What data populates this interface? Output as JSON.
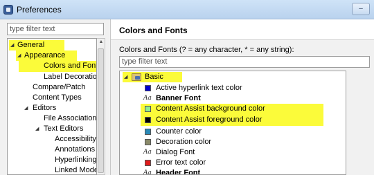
{
  "window": {
    "title": "Preferences"
  },
  "left_panel": {
    "filter_placeholder": "type filter text",
    "tree": [
      {
        "label": "General",
        "expanded": true
      },
      {
        "label": "Appearance",
        "expanded": true
      },
      {
        "label": "Colors and Fonts",
        "selected": true
      },
      {
        "label": "Label Decorations"
      },
      {
        "label": "Compare/Patch"
      },
      {
        "label": "Content Types"
      },
      {
        "label": "Editors",
        "expanded": true
      },
      {
        "label": "File Associations"
      },
      {
        "label": "Text Editors",
        "expanded": true
      },
      {
        "label": "Accessibility"
      },
      {
        "label": "Annotations"
      },
      {
        "label": "Hyperlinking"
      },
      {
        "label": "Linked Mode"
      }
    ]
  },
  "right_panel": {
    "title": "Colors and Fonts",
    "description": "Colors and Fonts (? = any character, * = any string):",
    "filter_placeholder": "type filter text",
    "group": {
      "label": "Basic"
    },
    "items": [
      {
        "label": "Active hyperlink text color",
        "kind": "color",
        "color": "#0000cc"
      },
      {
        "label": "Banner Font",
        "kind": "font",
        "bold": true
      },
      {
        "label": "Content Assist background color",
        "kind": "color",
        "color": "#90ee90"
      },
      {
        "label": "Content Assist foreground color",
        "kind": "color",
        "color": "#000000"
      },
      {
        "label": "Counter color",
        "kind": "color",
        "color": "#2a8ab8"
      },
      {
        "label": "Decoration color",
        "kind": "color",
        "color": "#8a8a6a"
      },
      {
        "label": "Dialog Font",
        "kind": "font",
        "bold": false
      },
      {
        "label": "Error text color",
        "kind": "color",
        "color": "#e01b1b"
      },
      {
        "label": "Header Font",
        "kind": "font",
        "bold": true
      }
    ],
    "font_icon_text": "Aa"
  },
  "colors": {
    "highlight": "#fbfb3a"
  }
}
